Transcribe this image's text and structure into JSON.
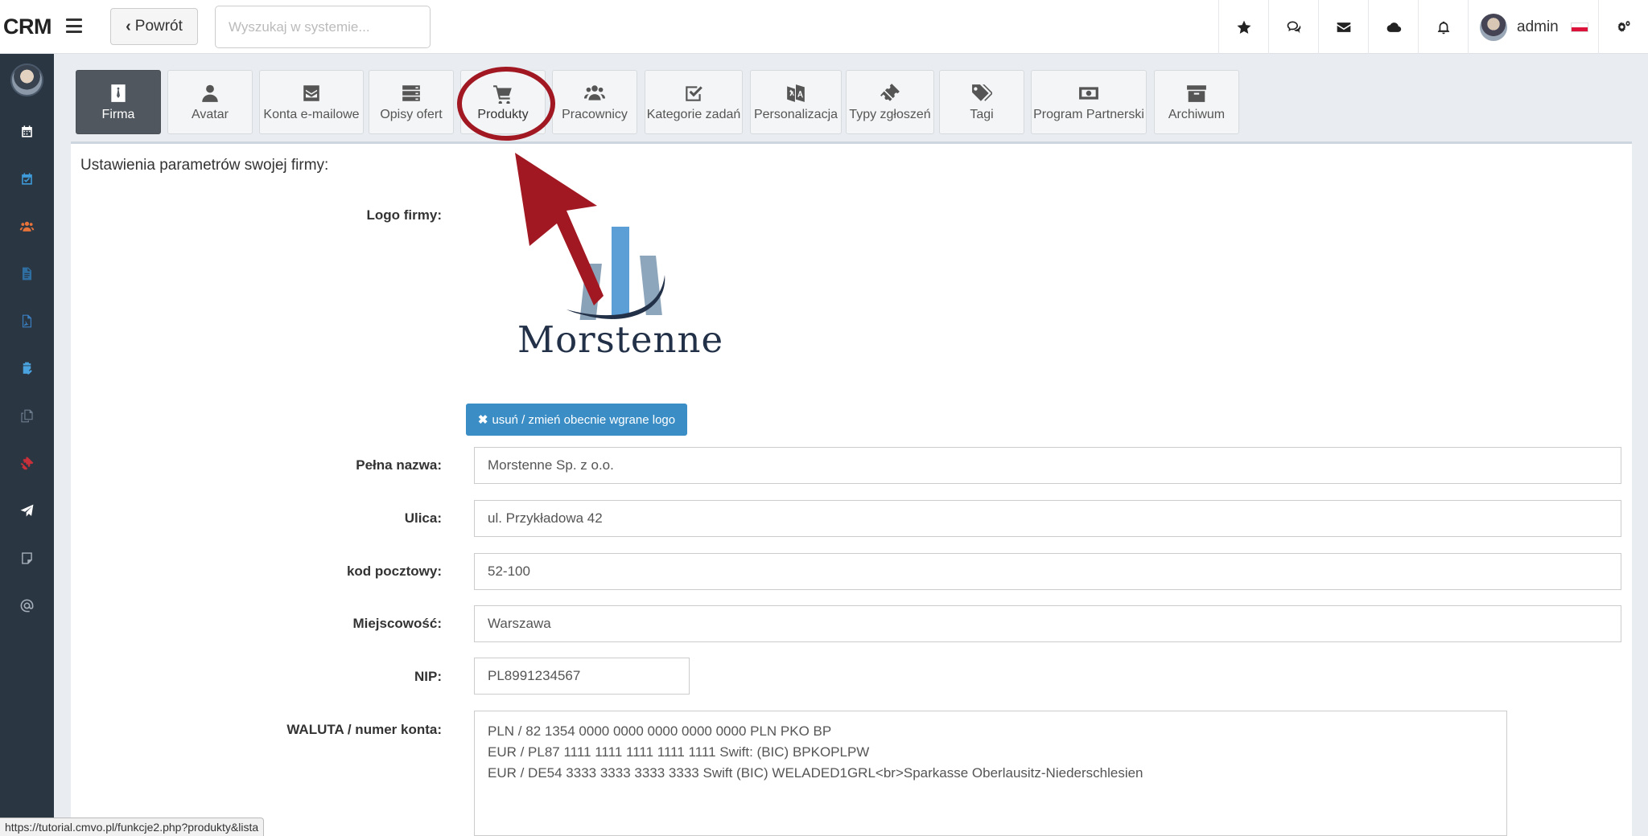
{
  "app": {
    "brand": "CRM"
  },
  "header": {
    "back_label": "Powrót",
    "search_placeholder": "Wyszukaj w systemie...",
    "user_name": "admin",
    "icons": [
      "star-icon",
      "comments-icon",
      "envelope-icon",
      "cloud-icon",
      "bell-icon",
      "settings-icon"
    ]
  },
  "sidebar": {
    "items": [
      {
        "icon": "calendar-icon",
        "color": "#ffffff"
      },
      {
        "icon": "calendar-check-icon",
        "color": "#3e9ad8"
      },
      {
        "icon": "users-icon",
        "color": "#e8733a"
      },
      {
        "icon": "document-icon",
        "color": "#2f6ea1"
      },
      {
        "icon": "pdf-icon",
        "color": "#3a7fc0"
      },
      {
        "icon": "clipboard-icon",
        "color": "#4aa3df"
      },
      {
        "icon": "copy-icon",
        "color": "#6c7b8b"
      },
      {
        "icon": "ticket-icon",
        "color": "#c8303a"
      },
      {
        "icon": "paper-plane-icon",
        "color": "#ffffff"
      },
      {
        "icon": "note-icon",
        "color": "#a6b0bb"
      },
      {
        "icon": "at-icon",
        "color": "#a6b0bb"
      }
    ]
  },
  "tabs": [
    {
      "label": "Firma",
      "icon": "tie-icon",
      "active": true
    },
    {
      "label": "Avatar",
      "icon": "user-icon"
    },
    {
      "label": "Konta e-mailowe",
      "icon": "envelope-icon"
    },
    {
      "label": "Opisy ofert",
      "icon": "server-icon"
    },
    {
      "label": "Produkty",
      "icon": "cart-icon",
      "highlighted": true
    },
    {
      "label": "Pracownicy",
      "icon": "users-icon"
    },
    {
      "label": "Kategorie zadań",
      "icon": "checkbox-icon"
    },
    {
      "label": "Personalizacja",
      "icon": "language-icon"
    },
    {
      "label": "Typy zgłoszeń",
      "icon": "ticket-icon"
    },
    {
      "label": "Tagi",
      "icon": "tags-icon"
    },
    {
      "label": "Program Partnerski",
      "icon": "money-icon"
    },
    {
      "label": "Archiwum",
      "icon": "archive-icon"
    }
  ],
  "main": {
    "title": "Ustawienia parametrów swojej firmy:",
    "logo_label": "Logo firmy:",
    "logo_company_text": "Morstenne",
    "logo_button": "usuń / zmień obecnie wgrane logo",
    "fields": {
      "full_name": {
        "label": "Pełna nazwa:",
        "value": "Morstenne Sp. z o.o."
      },
      "street": {
        "label": "Ulica:",
        "value": "ul. Przykładowa 42"
      },
      "postal": {
        "label": "kod pocztowy:",
        "value": "52-100"
      },
      "city": {
        "label": "Miejscowość:",
        "value": "Warszawa"
      },
      "nip": {
        "label": "NIP:",
        "value": "PL8991234567"
      },
      "currency": {
        "label": "WALUTA / numer konta:",
        "value": "PLN / 82 1354 0000 0000 0000 0000 0000 PLN PKO BP\nEUR / PL87 1111 1111 1111 1111 1111 Swift: (BIC) BPKOPLPW\nEUR / DE54 3333 3333 3333 3333 Swift (BIC) WELADED1GRL<br>Sparkasse Oberlausitz-Niederschlesien"
      }
    }
  },
  "status_url": "https://tutorial.cmvo.pl/funkcje2.php?produkty&lista",
  "colors": {
    "accent": "#3a8dc5",
    "annotation": "#a11722",
    "sidebar": "#2b3643"
  }
}
